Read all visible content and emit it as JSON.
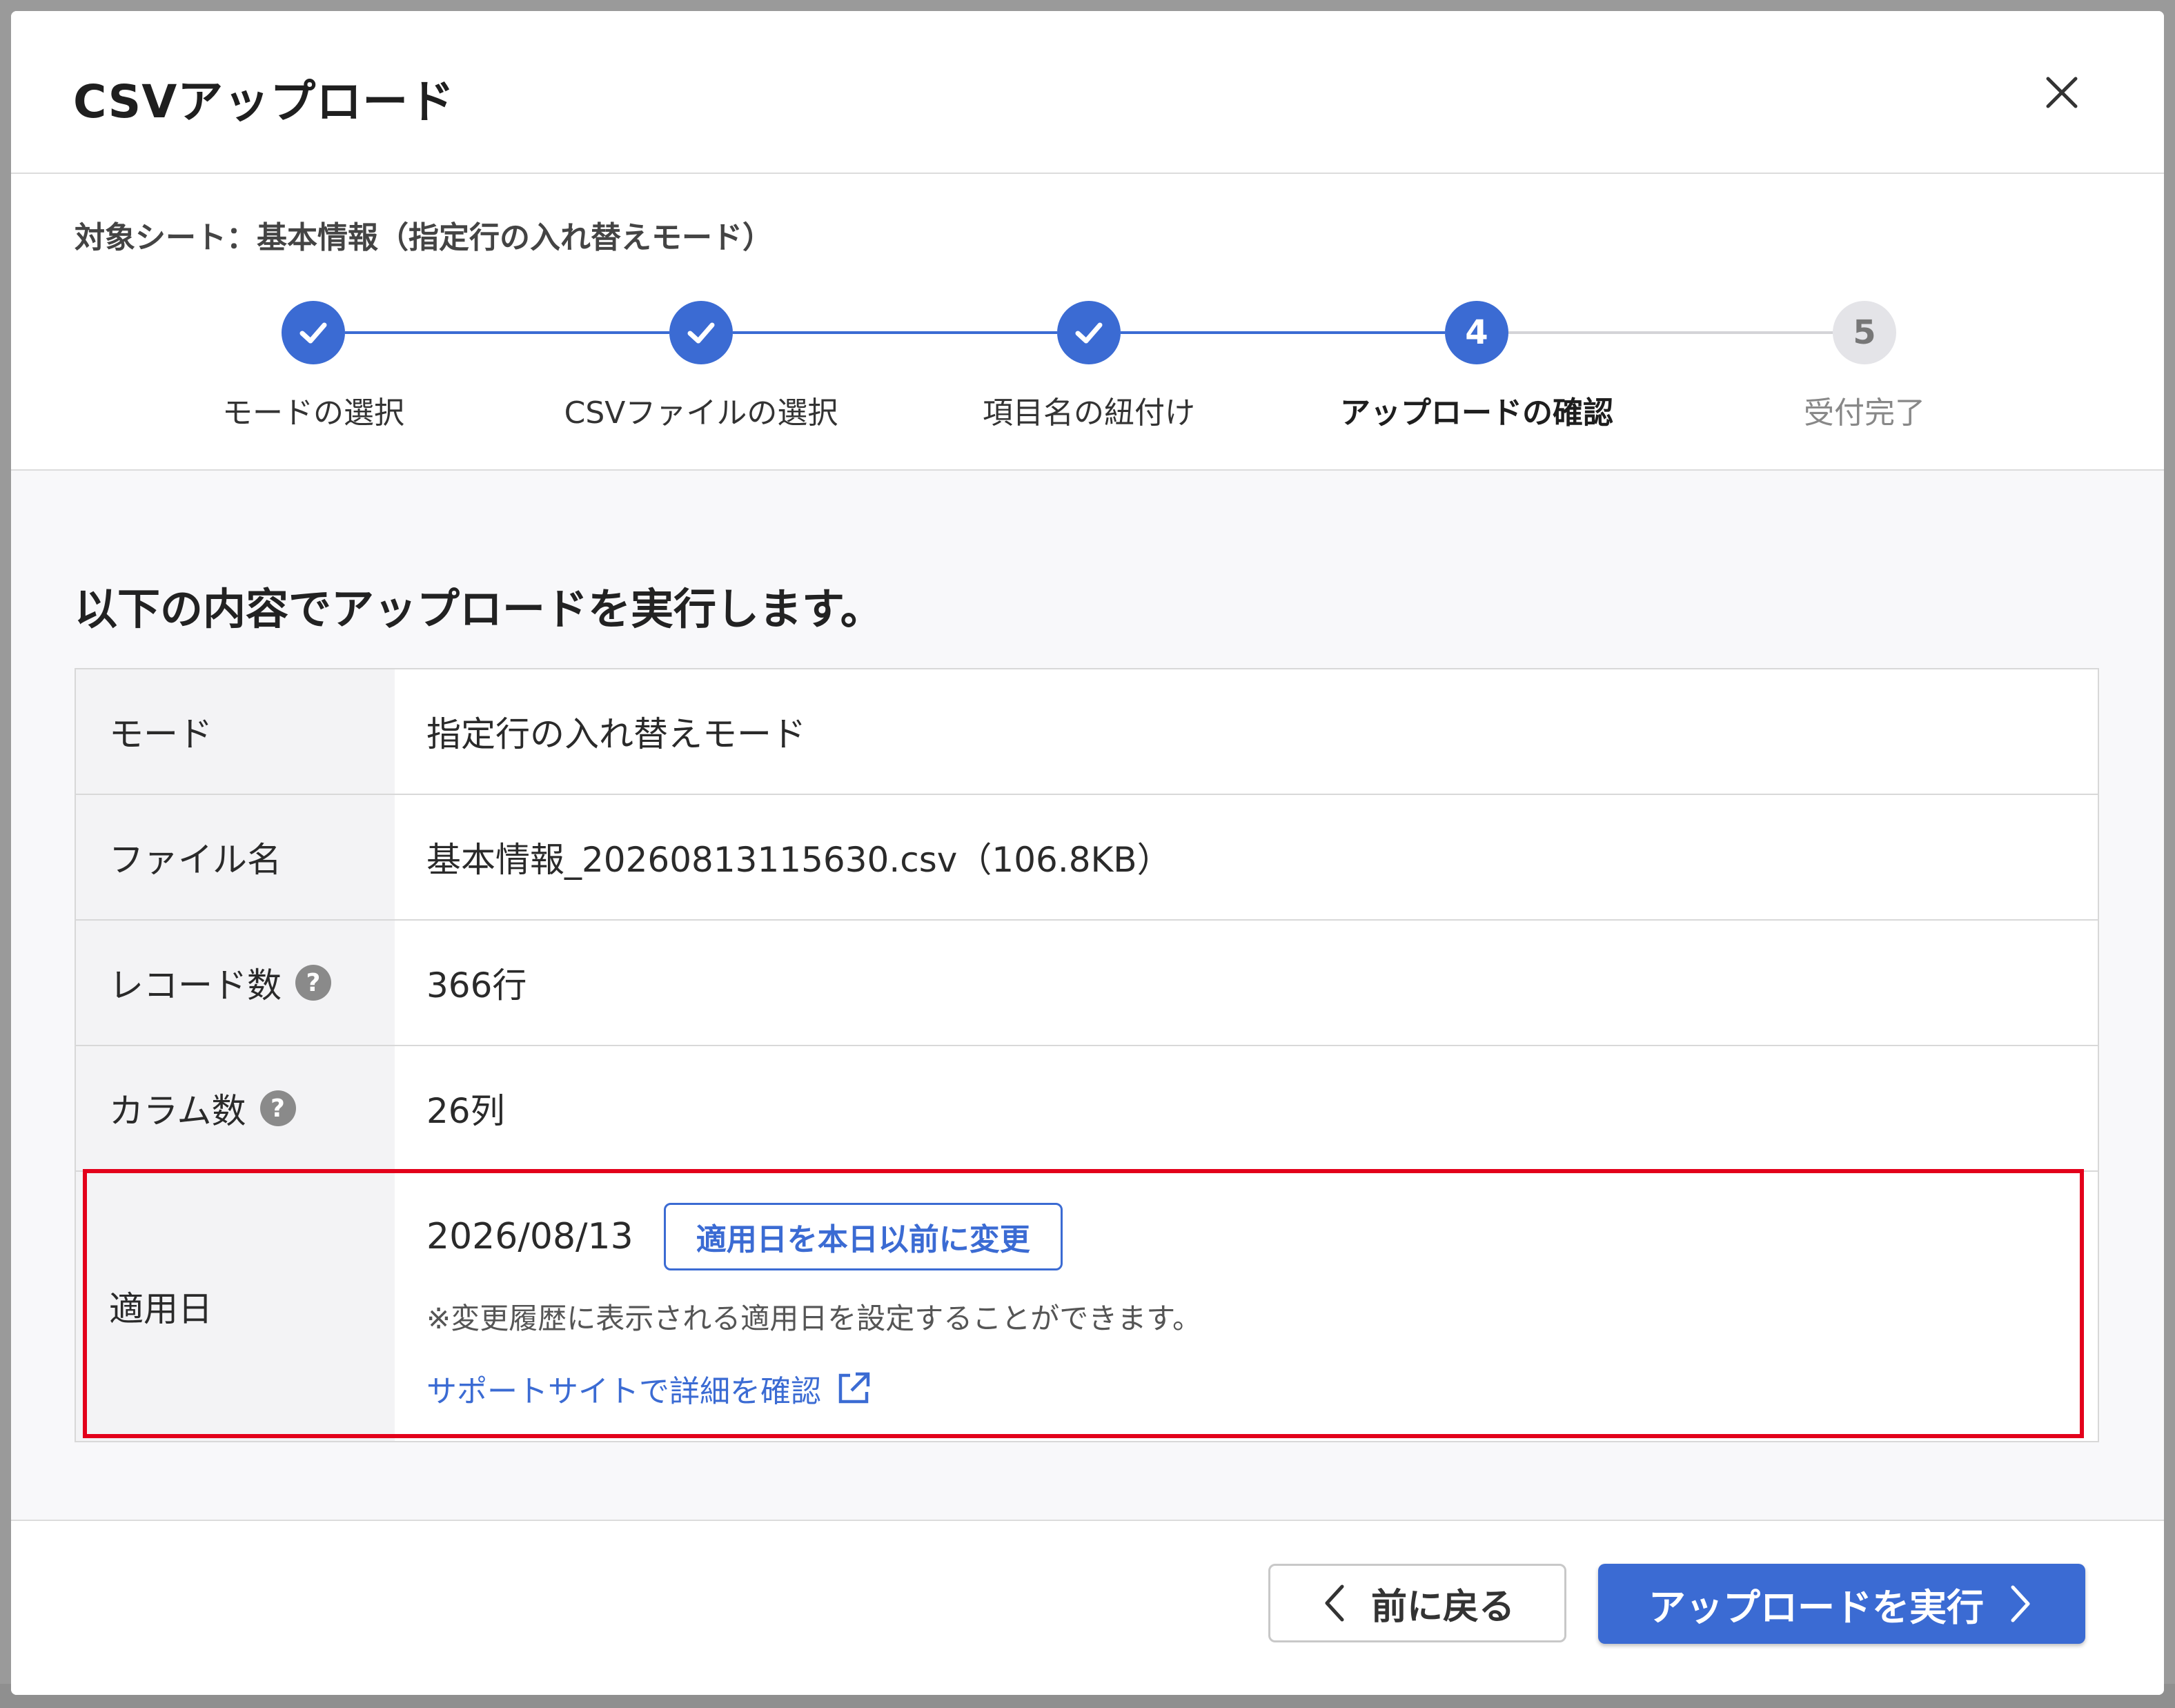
{
  "dialog": {
    "title": "CSVアップロード",
    "target_sheet": "対象シート：基本情報（指定行の入れ替えモード）"
  },
  "steps": [
    {
      "number": "1",
      "label": "モードの選択",
      "state": "done"
    },
    {
      "number": "2",
      "label": "CSVファイルの選択",
      "state": "done"
    },
    {
      "number": "3",
      "label": "項目名の紐付け",
      "state": "done"
    },
    {
      "number": "4",
      "label": "アップロードの確認",
      "state": "current"
    },
    {
      "number": "5",
      "label": "受付完了",
      "state": "pending"
    }
  ],
  "intro": "以下の内容でアップロードを実行します。",
  "summary": {
    "mode_label": "モード",
    "mode_value": "指定行の入れ替えモード",
    "file_label": "ファイル名",
    "file_value": "基本情報_20260813115630.csv（106.8KB）",
    "records_label": "レコード数",
    "records_value": "366行",
    "columns_label": "カラム数",
    "columns_value": "26列",
    "apply_label": "適用日",
    "apply_date": "2026/08/13",
    "change_button": "適用日を本日以前に変更",
    "note": "※変更履歴に表示される適用日を設定することができます。",
    "support_link": "サポートサイトで詳細を確認",
    "help_icon": "?"
  },
  "footer": {
    "back_label": "前に戻る",
    "execute_label": "アップロードを実行"
  },
  "colors": {
    "accent": "#3b6bd3",
    "highlight": "#e3001b",
    "pending_step": "#e4e4e8"
  },
  "icons": {
    "close": "close-icon",
    "check": "check-icon",
    "help": "help-icon",
    "external": "external-link-icon",
    "back": "chevron-left-icon",
    "next": "chevron-right-icon"
  }
}
